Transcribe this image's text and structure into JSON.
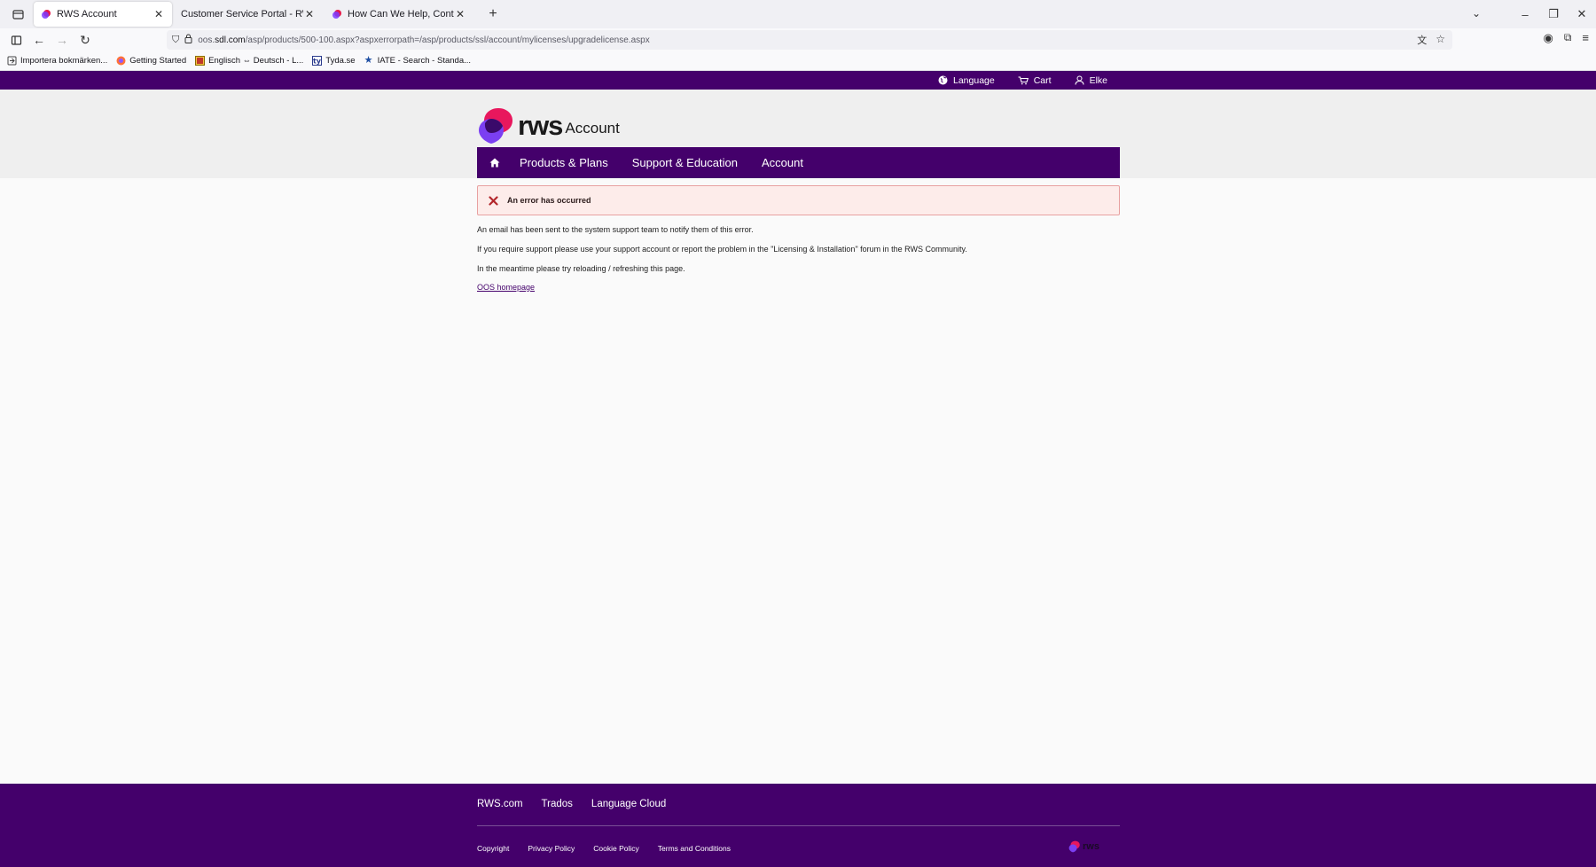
{
  "browser": {
    "tabs": [
      {
        "title": "RWS Account",
        "active": true
      },
      {
        "title": "Customer Service Portal - RWS Cust",
        "active": false
      },
      {
        "title": "How Can We Help, Contact Us",
        "active": false
      }
    ],
    "url": {
      "prefix": "oos.",
      "host": "sdl.com",
      "path": "/asp/products/500-100.aspx?aspxerrorpath=/asp/products/ssl/account/mylicenses/upgradelicense.aspx"
    },
    "bookmarks": [
      {
        "label": "Importera bokmärken...",
        "icon": "import-icon"
      },
      {
        "label": "Getting Started",
        "icon": "firefox-icon"
      },
      {
        "label": "Englisch ⇔ Deutsch - L...",
        "icon": "dictionary-icon"
      },
      {
        "label": "Tyda.se",
        "icon": "tyda-icon"
      },
      {
        "label": "IATE - Search - Standa...",
        "icon": "star-icon"
      }
    ]
  },
  "topbar": {
    "language": "Language",
    "cart": "Cart",
    "user": "Elke"
  },
  "logo": {
    "wordmark": "rws",
    "suffix": "Account"
  },
  "nav": {
    "items": [
      "Products & Plans",
      "Support & Education",
      "Account"
    ]
  },
  "error": {
    "title": "An error has occurred"
  },
  "messages": [
    "An email has been sent to the system support team to notify them of this error.",
    "If you require support please use your support account or report the problem in the \"Licensing & Installation\" forum in the RWS Community.",
    "In the meantime please try reloading / refreshing this page."
  ],
  "homepage_link": "OOS homepage",
  "footer": {
    "links": [
      "RWS.com",
      "Trados",
      "Language Cloud"
    ],
    "legal": [
      "Copyright",
      "Privacy Policy",
      "Cookie Policy",
      "Terms and Conditions"
    ],
    "logo_text": "rws"
  },
  "colors": {
    "brand_purple": "#44006b",
    "error_bg": "#fdecea",
    "error_x": "#b3262b"
  }
}
